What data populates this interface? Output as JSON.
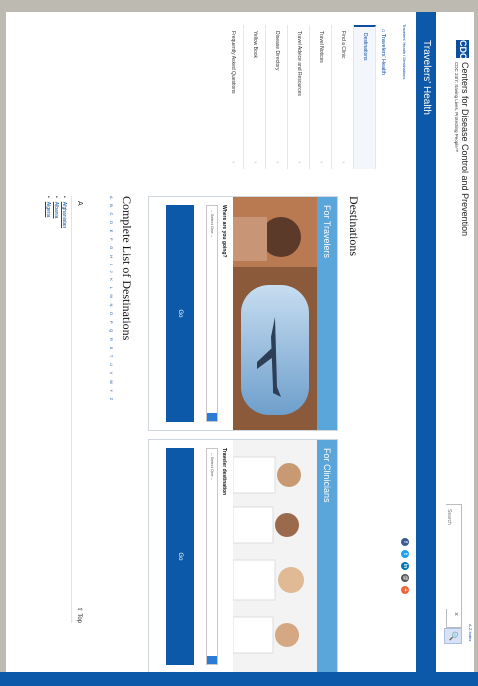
{
  "header": {
    "logo_text": "CDC",
    "org_name": "Centers for Disease Control and Prevention",
    "tagline": "CDC 24/7: Saving Lives, Protecting People™",
    "search_placeholder": "Search",
    "az_index": "A-Z Index",
    "clear_icon": "×",
    "search_icon": "🔍"
  },
  "site": {
    "title": "Travelers' Health"
  },
  "breadcrumb": {
    "home": "Travelers' Health",
    "separator": "/",
    "current": "Destinations"
  },
  "sidebar": {
    "heading": "Travelers' Health",
    "items": [
      {
        "label": "Destinations"
      },
      {
        "label": "Find a Clinic"
      },
      {
        "label": "Travel Notices"
      },
      {
        "label": "Travel Advice and Resources"
      },
      {
        "label": "Disease Directory"
      },
      {
        "label": "Yellow Book"
      },
      {
        "label": "Frequently Asked Questions"
      }
    ]
  },
  "main": {
    "title": "Destinations",
    "travelers_card": {
      "heading": "For Travelers",
      "label": "Where are you going?",
      "select_value": "-- Select One --",
      "go_label": "Go"
    },
    "clinicians_card": {
      "heading": "For Clinicians",
      "label": "Traveler destination",
      "select_value": "-- Select One --",
      "go_label": "Go"
    },
    "list_title": "Complete List of Destinations",
    "alphabet": "A B C D E F G H I J K L M N O P Q R S T U V W Y Z",
    "letter": "A",
    "top_label": "⇧ Top",
    "destinations": [
      "Afghanistan",
      "Albania",
      "Algeria"
    ]
  },
  "colors": {
    "brand_blue": "#0b59a8",
    "card_head": "#5aa5d9",
    "link": "#0b4ea2"
  }
}
